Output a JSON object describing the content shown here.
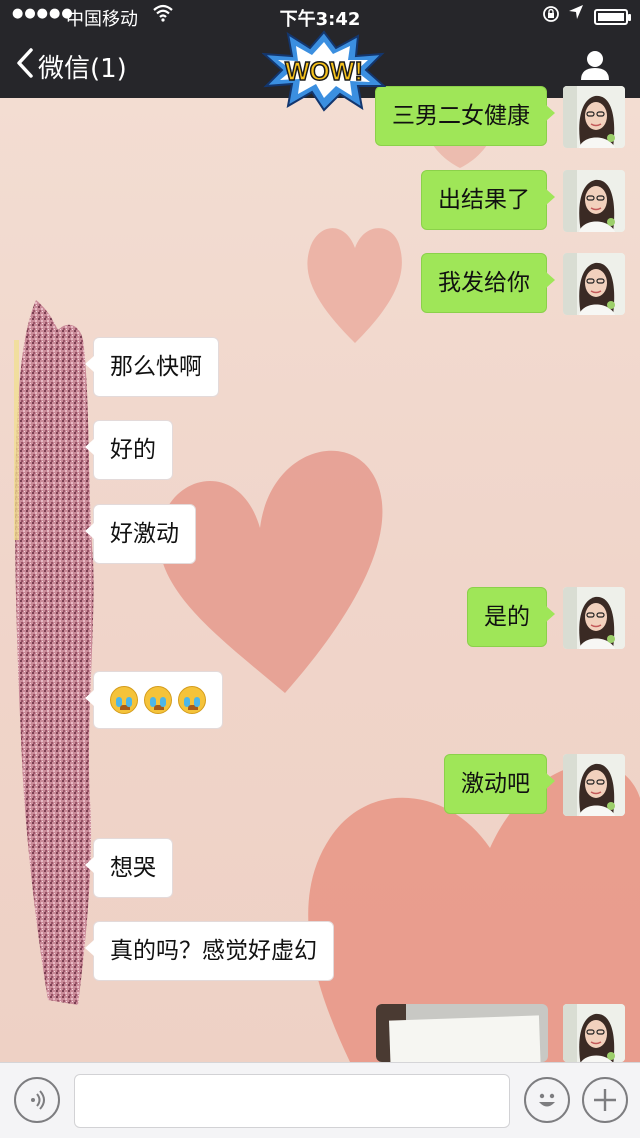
{
  "status_bar": {
    "signal": "●●●●●",
    "carrier": "中国移动",
    "time": "下午3:42"
  },
  "nav": {
    "back_label": "微信(1)",
    "sticker_text": "WOW!"
  },
  "messages": [
    {
      "side": "out",
      "text": "三男二女健康"
    },
    {
      "side": "out",
      "text": "出结果了"
    },
    {
      "side": "out",
      "text": "我发给你"
    },
    {
      "side": "in",
      "text": "那么快啊"
    },
    {
      "side": "in",
      "text": "好的"
    },
    {
      "side": "in",
      "text": "好激动"
    },
    {
      "side": "out",
      "text": "是的"
    },
    {
      "side": "in",
      "emoji": "crying-face",
      "count": 3
    },
    {
      "side": "out",
      "text": "激动吧"
    },
    {
      "side": "in",
      "text": "想哭"
    },
    {
      "side": "in",
      "text": "真的吗？感觉好虚幻"
    },
    {
      "side": "out",
      "image": "photo-of-document"
    }
  ],
  "colors": {
    "outgoing_bubble": "#9fe658",
    "incoming_bubble": "#ffffff",
    "bar": "#26262a"
  }
}
